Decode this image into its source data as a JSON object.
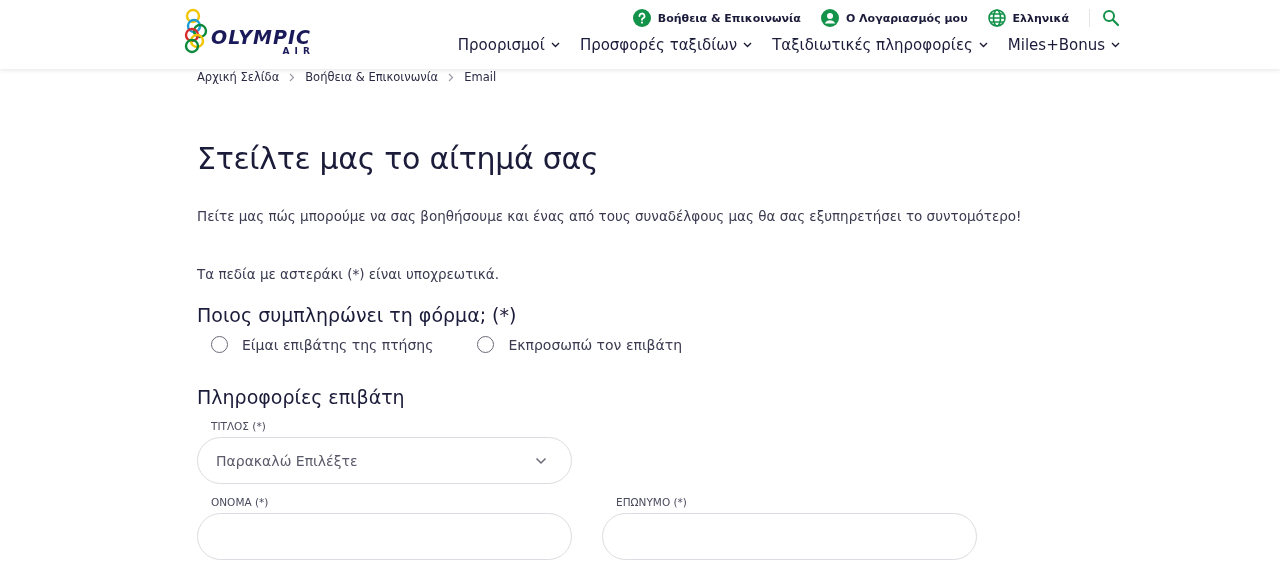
{
  "logo": {
    "name": "OLYMPIC",
    "sub": "A I R"
  },
  "utility_links": [
    {
      "label": "Βοήθεια & Επικοινωνία",
      "kind": "help"
    },
    {
      "label": "Ο Λογαριασμός μου",
      "kind": "account"
    },
    {
      "label": "Ελληνικά",
      "kind": "language"
    }
  ],
  "nav": [
    {
      "label": "Προορισμοί"
    },
    {
      "label": "Προσφορές ταξιδίων"
    },
    {
      "label": "Ταξιδιωτικές πληροφορίες"
    },
    {
      "label": "Miles+Bonus"
    }
  ],
  "breadcrumbs": [
    "Αρχική Σελίδα",
    "Βοήθεια & Επικοινωνία",
    "Email"
  ],
  "title": "Στείλτε μας το αίτημά σας",
  "intro": "Πείτε μας πώς μπορούμε να σας βοηθήσουμε και ένας από τους συναδέλφους μας θα σας εξυπηρετήσει το συντομότερο!",
  "required_note": "Τα πεδία με αστεράκι (*) είναι υποχρεωτικά.",
  "who_question": {
    "heading": "Ποιος συμπληρώνει τη φόρμα; (*)",
    "options": [
      {
        "label": "Είμαι επιβάτης της πτήσης",
        "selected": false
      },
      {
        "label": "Εκπροσωπώ τον επιβάτη",
        "selected": false
      }
    ]
  },
  "passenger_section": {
    "heading": "Πληροφορίες επιβάτη",
    "rows": [
      [
        {
          "kind": "select",
          "label": "ΤΙΤΛΟΣ (*)",
          "placeholder": "Παρακαλώ Επιλέξτε"
        }
      ],
      [
        {
          "kind": "text",
          "label": "ΟΝΟΜΑ (*)"
        },
        {
          "kind": "text",
          "label": "ΕΠΩΝΥΜΟ (*)"
        }
      ]
    ]
  }
}
